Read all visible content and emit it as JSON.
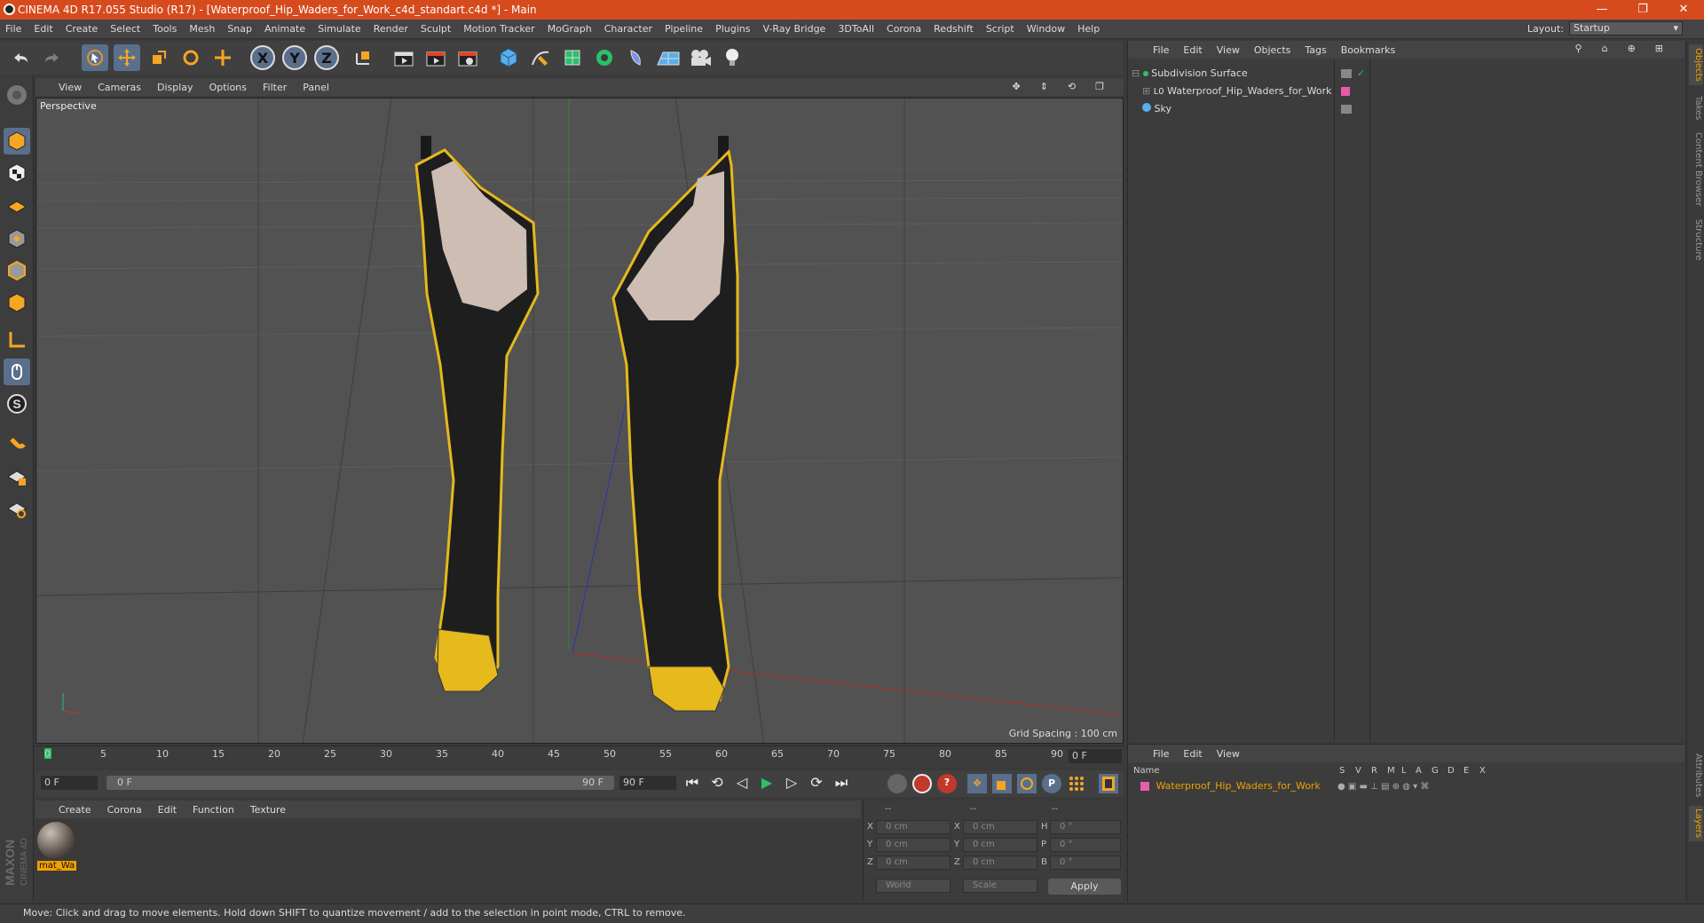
{
  "window": {
    "title": "CINEMA 4D R17.055 Studio (R17) - [Waterproof_Hip_Waders_for_Work_c4d_standart.c4d *] - Main",
    "controls": [
      "—",
      "❐",
      "✕"
    ]
  },
  "menu": [
    "File",
    "Edit",
    "Create",
    "Select",
    "Tools",
    "Mesh",
    "Snap",
    "Animate",
    "Simulate",
    "Render",
    "Sculpt",
    "Motion Tracker",
    "MoGraph",
    "Character",
    "Pipeline",
    "Plugins",
    "V-Ray Bridge",
    "3DToAll",
    "Corona",
    "Redshift",
    "Script",
    "Window",
    "Help"
  ],
  "layout": {
    "label": "Layout:",
    "value": "Startup"
  },
  "toolbar": {
    "axis_x": "X",
    "axis_y": "Y",
    "axis_z": "Z"
  },
  "viewport": {
    "menu": [
      "View",
      "Cameras",
      "Display",
      "Options",
      "Filter",
      "Panel"
    ],
    "label": "Perspective",
    "grid_spacing": "Grid Spacing : 100 cm"
  },
  "timeline": {
    "ticks": [
      "0",
      "5",
      "10",
      "15",
      "20",
      "25",
      "30",
      "35",
      "40",
      "45",
      "50",
      "55",
      "60",
      "65",
      "70",
      "75",
      "80",
      "85",
      "90"
    ],
    "current_frame": "0 F",
    "start_frame": "0 F",
    "range_start": "0 F",
    "range_end": "90 F",
    "end_frame": "90 F"
  },
  "material_manager": {
    "menu": [
      "Create",
      "Corona",
      "Edit",
      "Function",
      "Texture"
    ],
    "materials": [
      {
        "name": "mat_Wa"
      }
    ]
  },
  "coordinates": {
    "headers": [
      "--",
      "--",
      "--"
    ],
    "rows": [
      {
        "a": "X",
        "av": "0 cm",
        "b": "X",
        "bv": "0 cm",
        "c": "H",
        "cv": "0 °"
      },
      {
        "a": "Y",
        "av": "0 cm",
        "b": "Y",
        "bv": "0 cm",
        "c": "P",
        "cv": "0 °"
      },
      {
        "a": "Z",
        "av": "0 cm",
        "b": "Z",
        "bv": "0 cm",
        "c": "B",
        "cv": "0 °"
      }
    ],
    "mode": "World",
    "scale": "Scale",
    "apply": "Apply"
  },
  "object_manager": {
    "menu": [
      "File",
      "Edit",
      "View",
      "Objects",
      "Tags",
      "Bookmarks"
    ],
    "objects": [
      {
        "name": "Subdivision Surface"
      },
      {
        "name": "Waterproof_Hip_Waders_for_Work"
      },
      {
        "name": "Sky"
      }
    ]
  },
  "layer_manager": {
    "menu": [
      "File",
      "Edit",
      "View"
    ],
    "columns": [
      "Name",
      "S",
      "V",
      "R",
      "M",
      "L",
      "A",
      "G",
      "D",
      "E",
      "X"
    ],
    "layers": [
      {
        "name": "Waterproof_Hip_Waders_for_Work",
        "color": "#e85ca8"
      }
    ]
  },
  "side_tabs": [
    "Objects",
    "Takes",
    "Content Browser",
    "Structure"
  ],
  "side_tabs_bottom": [
    "Attributes",
    "Layers"
  ],
  "status": "Move: Click and drag to move elements. Hold down SHIFT to quantize movement / add to the selection in point mode, CTRL to remove.",
  "brand": {
    "line1": "MAXON",
    "line2": "CINEMA 4D"
  },
  "colors": {
    "accent": "#d64b1e",
    "selected_text": "#f0a000",
    "boot": "#1c1c1c",
    "trim": "#e6b91c"
  }
}
